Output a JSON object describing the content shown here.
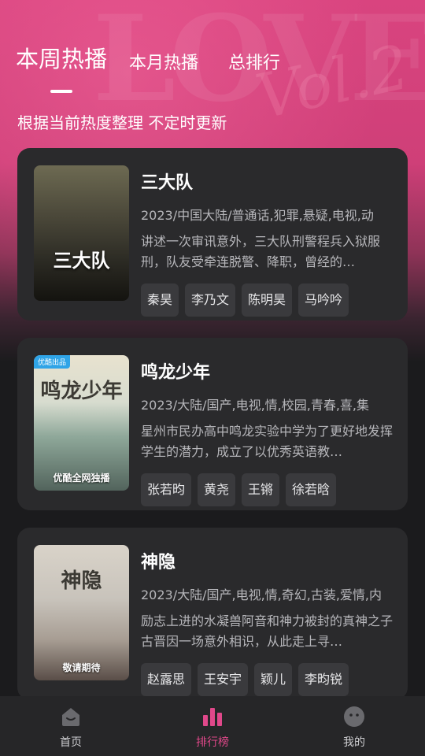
{
  "tabs": [
    {
      "label": "本周热播",
      "active": true
    },
    {
      "label": "本月热播",
      "active": false
    },
    {
      "label": "总排行",
      "active": false
    }
  ],
  "hero": {
    "deco_main": "LOVE",
    "deco_script": "Vol.2"
  },
  "subtitle": "根据当前热度整理 不定时更新",
  "items": [
    {
      "title": "三大队",
      "poster_title": "三大队",
      "meta": "2023/中国大陆/普通话,犯罪,悬疑,电视,动",
      "desc": "讲述一次审讯意外，三大队刑警程兵入狱服刑，队友受牵连脱警、降职，曾经的…",
      "actors": [
        "秦昊",
        "李乃文",
        "陈明昊",
        "马吟吟"
      ]
    },
    {
      "title": "鸣龙少年",
      "poster_title": "鸣龙少年",
      "poster_corner": "优酷出品",
      "poster_badge": "优酷全网独播",
      "meta": "2023/大陆/国产,电视,情,校园,青春,喜,集",
      "desc": "星州市民办高中鸣龙实验中学为了更好地发挥学生的潜力，成立了以优秀英语教…",
      "actors": [
        "张若昀",
        "黄尧",
        "王锵",
        "徐若晗"
      ]
    },
    {
      "title": "神隐",
      "poster_title": "神隐",
      "poster_badge": "敬请期待",
      "meta": "2023/大陆/国产,电视,情,奇幻,古装,爱情,内",
      "desc": "励志上进的水凝兽阿音和神力被封的真神之子古晋因一场意外相识，从此走上寻…",
      "actors": [
        "赵露思",
        "王安宇",
        "颖儿",
        "李昀锐"
      ]
    }
  ],
  "nav": [
    {
      "label": "首页",
      "icon": "home-icon",
      "active": false
    },
    {
      "label": "排行榜",
      "icon": "ranking-icon",
      "active": true
    },
    {
      "label": "我的",
      "icon": "profile-icon",
      "active": false
    }
  ],
  "colors": {
    "accent": "#e0488a",
    "background": "#1b1b1d",
    "card": "#2a2a2c"
  }
}
